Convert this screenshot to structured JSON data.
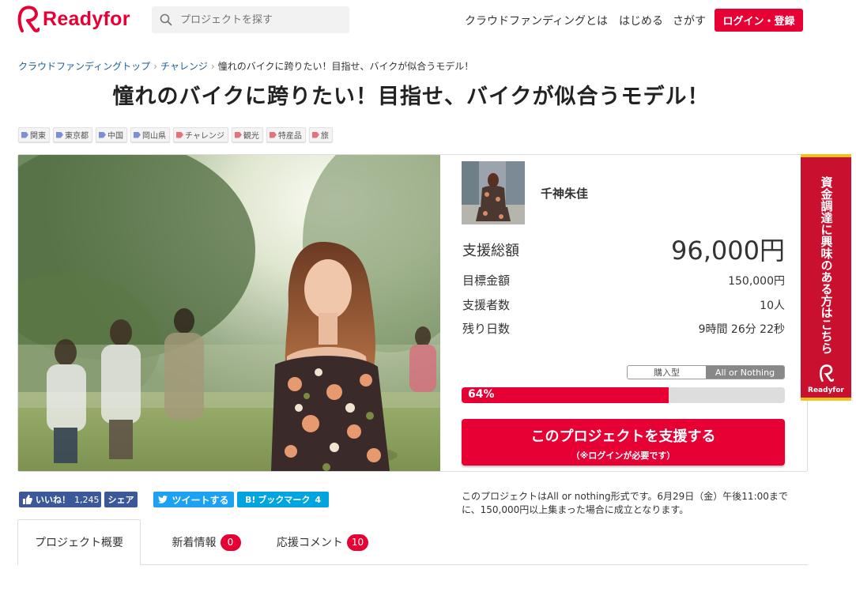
{
  "header": {
    "logo_text": "Readyfor",
    "search_placeholder": "プロジェクトを探す",
    "nav": [
      "クラウドファンディングとは",
      "はじめる",
      "さがす"
    ],
    "login_label": "ログイン・登録"
  },
  "breadcrumb": [
    "クラウドファンディングトップ",
    "チャレンジ",
    "憧れのバイクに跨りたい！目指せ、バイクが似合うモデル！"
  ],
  "project": {
    "title": "憧れのバイクに跨りたい！目指せ、バイクが似合うモデル！",
    "tags": [
      {
        "label": "関東",
        "color": "#7b8fd8"
      },
      {
        "label": "東京都",
        "color": "#7b8fd8"
      },
      {
        "label": "中国",
        "color": "#7b8fd8"
      },
      {
        "label": "岡山県",
        "color": "#7b8fd8"
      },
      {
        "label": "チャレンジ",
        "color": "#e8707a"
      },
      {
        "label": "観光",
        "color": "#e8707a"
      },
      {
        "label": "特産品",
        "color": "#e8707a"
      },
      {
        "label": "旅",
        "color": "#e8707a"
      }
    ],
    "owner_name": "千神朱佳",
    "total_label": "支援総額",
    "total_value": "96,000円",
    "goal_label": "目標金額",
    "goal_value": "150,000円",
    "supporters_label": "支援者数",
    "supporters_value": "10人",
    "remaining_label": "残り日数",
    "remaining_value": "9時間 26分 22秒",
    "type_options": [
      "購入型",
      "All or Nothing"
    ],
    "progress_percent": 64,
    "progress_label": "64%",
    "support_button_main": "このプロジェクトを支援する",
    "support_button_sub": "（※ログインが必要です）"
  },
  "side_banner": {
    "text": "資金調達に興味のある方はこちら",
    "logo": "Readyfor"
  },
  "social": {
    "facebook_like": "いいね！",
    "facebook_count": "1,245",
    "facebook_share": "シェア",
    "tweet": "ツイートする",
    "hatena": "ブックマーク",
    "hatena_prefix": "B!",
    "hatena_count": "4"
  },
  "note": "このプロジェクトはAll or nothing形式です。6月29日（金）午後11:00までに、150,000円以上集まった場合に成立となります。",
  "tabs": [
    {
      "label": "プロジェクト概要"
    },
    {
      "label": "新着情報",
      "badge": "0"
    },
    {
      "label": "応援コメント",
      "badge": "10"
    }
  ],
  "colors": {
    "brand": "#e60033",
    "link": "#1a5e9a",
    "facebook": "#3b5998",
    "twitter": "#1da1f2",
    "hatena": "#00a4de"
  }
}
